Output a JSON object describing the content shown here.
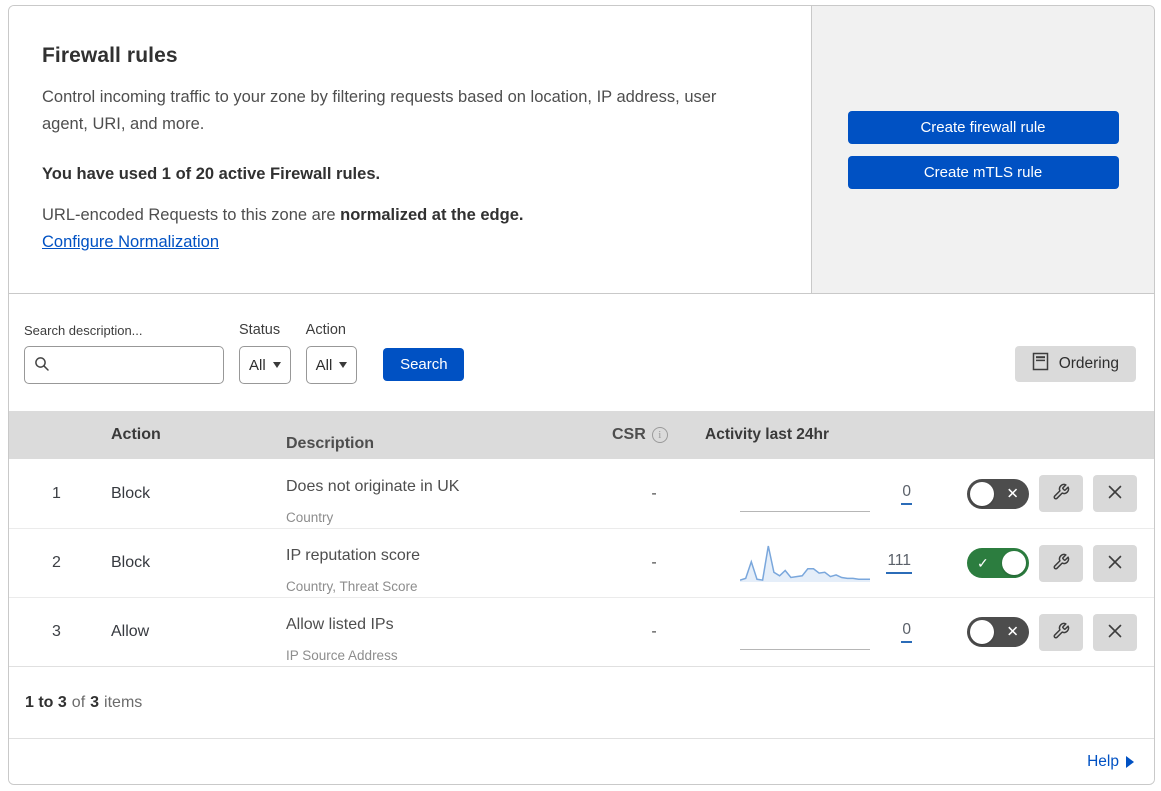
{
  "header": {
    "title": "Firewall rules",
    "description": "Control incoming traffic to your zone by filtering requests based on location, IP address, user agent, URI, and more.",
    "usage_notice": "You have used 1 of 20 active Firewall rules.",
    "normalization_text": "URL-encoded Requests to this zone are",
    "normalization_bold": "normalized at the edge.",
    "normalization_link": "Configure Normalization"
  },
  "actions_panel": {
    "create_firewall_rule": "Create firewall rule",
    "create_mtls_rule": "Create mTLS rule"
  },
  "filters": {
    "search_label": "Search description...",
    "status_label": "Status",
    "status_value": "All",
    "action_label": "Action",
    "action_value": "All",
    "search_button": "Search",
    "ordering_button": "Ordering"
  },
  "table": {
    "headers": {
      "action": "Action",
      "description": "Description",
      "csr": "CSR",
      "activity": "Activity last 24hr"
    },
    "rows": [
      {
        "priority": "1",
        "action": "Block",
        "description": "Does not originate in UK",
        "match_fields": "Country",
        "csr": "-",
        "activity_count": "0",
        "enabled": false,
        "sparkline": []
      },
      {
        "priority": "2",
        "action": "Block",
        "description": "IP reputation score",
        "match_fields": "Country, Threat Score",
        "csr": "-",
        "activity_count": "111",
        "enabled": true,
        "sparkline": [
          1,
          3,
          22,
          2,
          1,
          40,
          10,
          6,
          12,
          4,
          5,
          6,
          14,
          14,
          9,
          10,
          5,
          7,
          4,
          3,
          3,
          2,
          2,
          2
        ]
      },
      {
        "priority": "3",
        "action": "Allow",
        "description": "Allow listed IPs",
        "match_fields": "IP Source Address",
        "csr": "-",
        "activity_count": "0",
        "enabled": false,
        "sparkline": []
      }
    ]
  },
  "footer": {
    "range": "1 to 3",
    "of_text": "of",
    "total": "3",
    "items_text": "items",
    "help": "Help"
  },
  "colors": {
    "accent_blue": "#0051c3",
    "toggle_on_green": "#2c7d3f",
    "toggle_off_gray": "#4d4d4d",
    "sparkline_blue": "#7aa7dc",
    "sparkline_fill": "rgba(110,160,220,0.18)",
    "table_header_bg": "#dbdbdb",
    "panel_gray": "#f1f1f1"
  }
}
